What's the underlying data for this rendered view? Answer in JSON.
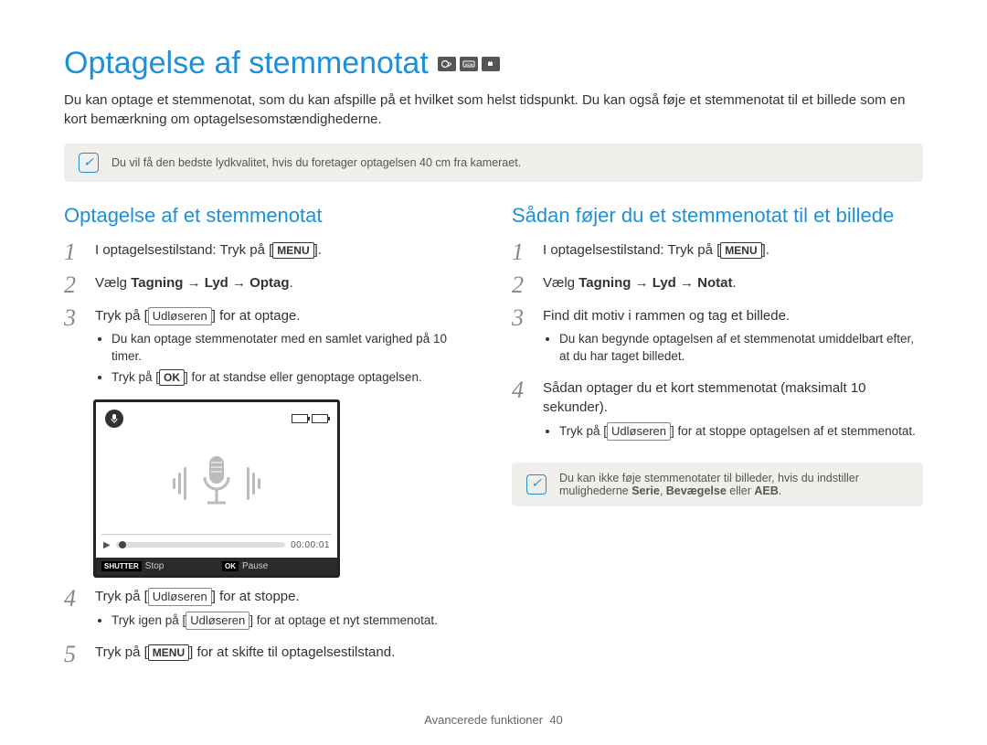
{
  "title": "Optagelse af stemmenotat",
  "intro": "Du kan optage et stemmenotat, som du kan afspille på et hvilket som helst tidspunkt. Du kan også føje et stemmenotat til et billede som en kort bemærkning om optagelsesomstændighederne.",
  "note1": "Du vil få den bedste lydkvalitet, hvis du foretager optagelsen 40 cm fra kameraet.",
  "left": {
    "title": "Optagelse af et stemmenotat",
    "s1_a": "I optagelsestilstand: Tryk på [",
    "s1_b": "MENU",
    "s1_c": "].",
    "s2_a": "Vælg ",
    "s2_b": "Tagning → Lyd → Optag",
    "s2_c": ".",
    "s3_a": "Tryk på [",
    "s3_b": "Udløseren",
    "s3_c": "] for at optage.",
    "s3_li1": "Du kan optage stemmenotater med en samlet varighed på 10 timer.",
    "s3_li2_a": "Tryk på [",
    "s3_li2_b": "OK",
    "s3_li2_c": "] for at standse eller genoptage optagelsen.",
    "s4_a": "Tryk på [",
    "s4_b": "Udløseren",
    "s4_c": "] for at stoppe.",
    "s4_li1_a": "Tryk igen på [",
    "s4_li1_b": "Udløseren",
    "s4_li1_c": "] for at optage et nyt stemmenotat.",
    "s5_a": "Tryk på [",
    "s5_b": "MENU",
    "s5_c": "] for at skifte til optagelsestilstand.",
    "screen_time": "00:00:01",
    "screen_shutter": "SHUTTER",
    "screen_stop": "Stop",
    "screen_ok": "OK",
    "screen_pause": "Pause"
  },
  "right": {
    "title": "Sådan føjer du et stemmenotat til et billede",
    "s1_a": "I optagelsestilstand: Tryk på [",
    "s1_b": "MENU",
    "s1_c": "].",
    "s2_a": "Vælg ",
    "s2_b": "Tagning → Lyd → Notat",
    "s2_c": ".",
    "s3": "Find dit motiv i rammen og tag et billede.",
    "s3_li1": "Du kan begynde optagelsen af et stemmenotat umiddelbart efter, at du har taget billedet.",
    "s4": "Sådan optager du et kort stemmenotat (maksimalt 10 sekunder).",
    "s4_li_a": "Tryk på [",
    "s4_li_b": "Udløseren",
    "s4_li_c": "] for at stoppe optagelsen af et stemmenotat.",
    "note_a": "Du kan ikke føje stemmenotater til billeder, hvis du indstiller mulighederne ",
    "note_b": "Serie",
    "note_c": ", ",
    "note_d": "Bevægelse",
    "note_e": " eller ",
    "note_f": "AEB",
    "note_g": "."
  },
  "footer_text": "Avancerede funktioner",
  "footer_page": "40"
}
